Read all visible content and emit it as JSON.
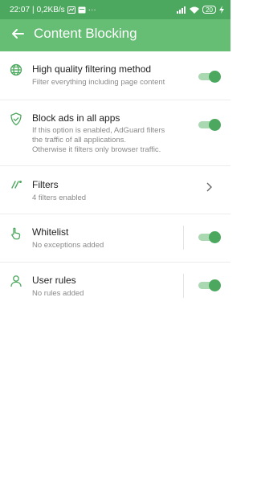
{
  "status_bar": {
    "time": "22:07",
    "network_speed": "0,2KB/s",
    "battery": "20"
  },
  "app_bar": {
    "back_icon": "arrow-left-icon",
    "title": "Content Blocking"
  },
  "colors": {
    "primary": "#66bd74",
    "status_bar": "#4da85f",
    "toggle_on": "#4da85f"
  },
  "items": [
    {
      "icon": "globe-icon",
      "title": "High quality filtering method",
      "subtitle": "Filter everything including page content",
      "control": "toggle",
      "enabled": true
    },
    {
      "icon": "shield-icon",
      "title": "Block ads in all apps",
      "subtitle_lines": [
        "If this option is enabled, AdGuard filters",
        "the traffic of all applications.",
        "Otherwise it filters only browser traffic."
      ],
      "control": "toggle",
      "enabled": true
    },
    {
      "icon": "filter-icon",
      "title": "Filters",
      "subtitle": "4 filters enabled",
      "control": "chevron"
    },
    {
      "icon": "hand-icon",
      "title": "Whitelist",
      "subtitle": "No exceptions added",
      "control": "toggle",
      "enabled": true
    },
    {
      "icon": "user-icon",
      "title": "User rules",
      "subtitle": "No rules added",
      "control": "toggle",
      "enabled": true
    }
  ]
}
